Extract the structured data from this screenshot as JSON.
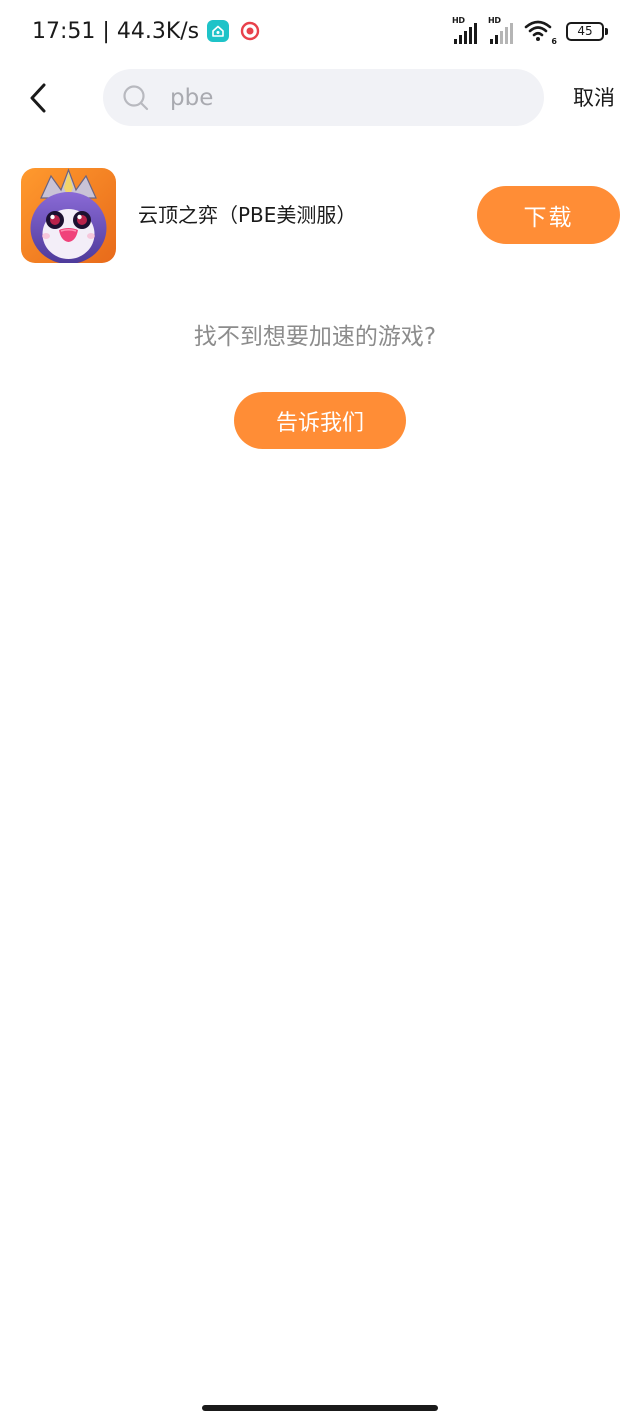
{
  "status_bar": {
    "time": "17:51",
    "separator": "|",
    "net_speed": "44.3K/s",
    "signal_1_label": "HD",
    "signal_2_label": "HD",
    "wifi_tag": "6",
    "battery": "45"
  },
  "search": {
    "query": "pbe",
    "cancel_label": "取消"
  },
  "results": [
    {
      "title": "云顶之弈（PBE美测服）",
      "action_label": "下载"
    }
  ],
  "empty_hint": {
    "text": "找不到想要加速的游戏?",
    "button_label": "告诉我们"
  },
  "colors": {
    "accent": "#ff8d36",
    "search_bg": "#f1f2f6",
    "hint_text": "#8c8c8c"
  },
  "icons": {
    "back": "chevron-left-icon",
    "search": "search-icon",
    "game": "tft-penguin-icon"
  }
}
